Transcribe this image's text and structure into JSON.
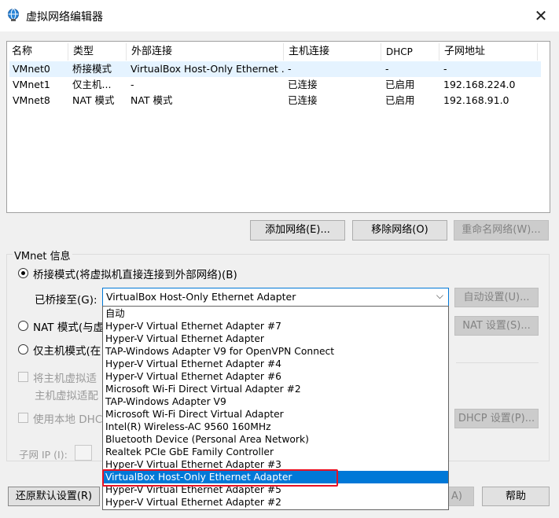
{
  "window": {
    "title": "虚拟网络编辑器",
    "icon": "globe-network-icon"
  },
  "list": {
    "columns": [
      "名称",
      "类型",
      "外部连接",
      "主机连接",
      "DHCP",
      "子网地址"
    ],
    "rows": [
      {
        "name": "VMnet0",
        "type": "桥接模式",
        "external": "VirtualBox Host-Only Ethernet ...",
        "host": "-",
        "dhcp": "-",
        "subnet": "-"
      },
      {
        "name": "VMnet1",
        "type": "仅主机...",
        "external": "-",
        "host": "已连接",
        "dhcp": "已启用",
        "subnet": "192.168.224.0"
      },
      {
        "name": "VMnet8",
        "type": "NAT 模式",
        "external": "NAT 模式",
        "host": "已连接",
        "dhcp": "已启用",
        "subnet": "192.168.91.0"
      }
    ]
  },
  "buttons": {
    "add": "添加网络(E)...",
    "remove": "移除网络(O)",
    "rename": "重命名网络(W)...",
    "auto": "自动设置(U)...",
    "nat": "NAT 设置(S)...",
    "dhcp": "DHCP 设置(P)...",
    "restore": "还原默认设置(R)",
    "apply": "A)",
    "help": "帮助"
  },
  "vmnet": {
    "group_title": "VMnet 信息",
    "bridge_label": "桥接模式(将虚拟机直接连接到外部网络)(B)",
    "nat_label": "NAT 模式(与虚",
    "hostonly_label": "仅主机模式(在",
    "connect_host_label": "将主机虚拟适",
    "host_adapter_name": "主机虚拟适配",
    "use_dhcp_label": "使用本地 DHC",
    "subnet_ip_label": "子网 IP (I):"
  },
  "bridged": {
    "label": "已桥接至(G):",
    "selected": "VirtualBox Host-Only Ethernet Adapter",
    "options": [
      "自动",
      "Hyper-V Virtual Ethernet Adapter #7",
      "Hyper-V Virtual Ethernet Adapter",
      "TAP-Windows Adapter V9 for OpenVPN Connect",
      "Hyper-V Virtual Ethernet Adapter #4",
      "Hyper-V Virtual Ethernet Adapter #6",
      "Microsoft Wi-Fi Direct Virtual Adapter #2",
      "TAP-Windows Adapter V9",
      "Microsoft Wi-Fi Direct Virtual Adapter",
      "Intel(R) Wireless-AC 9560 160MHz",
      "Bluetooth Device (Personal Area Network)",
      "Realtek PCIe GbE Family Controller",
      "Hyper-V Virtual Ethernet Adapter #3",
      "VirtualBox Host-Only Ethernet Adapter",
      "Hyper-V Virtual Ethernet Adapter #5",
      "Hyper-V Virtual Ethernet Adapter #2"
    ],
    "selected_index": 13
  },
  "colors": {
    "accent": "#0078d7",
    "highlight": "#e81123",
    "row_select": "#e5f3ff"
  }
}
